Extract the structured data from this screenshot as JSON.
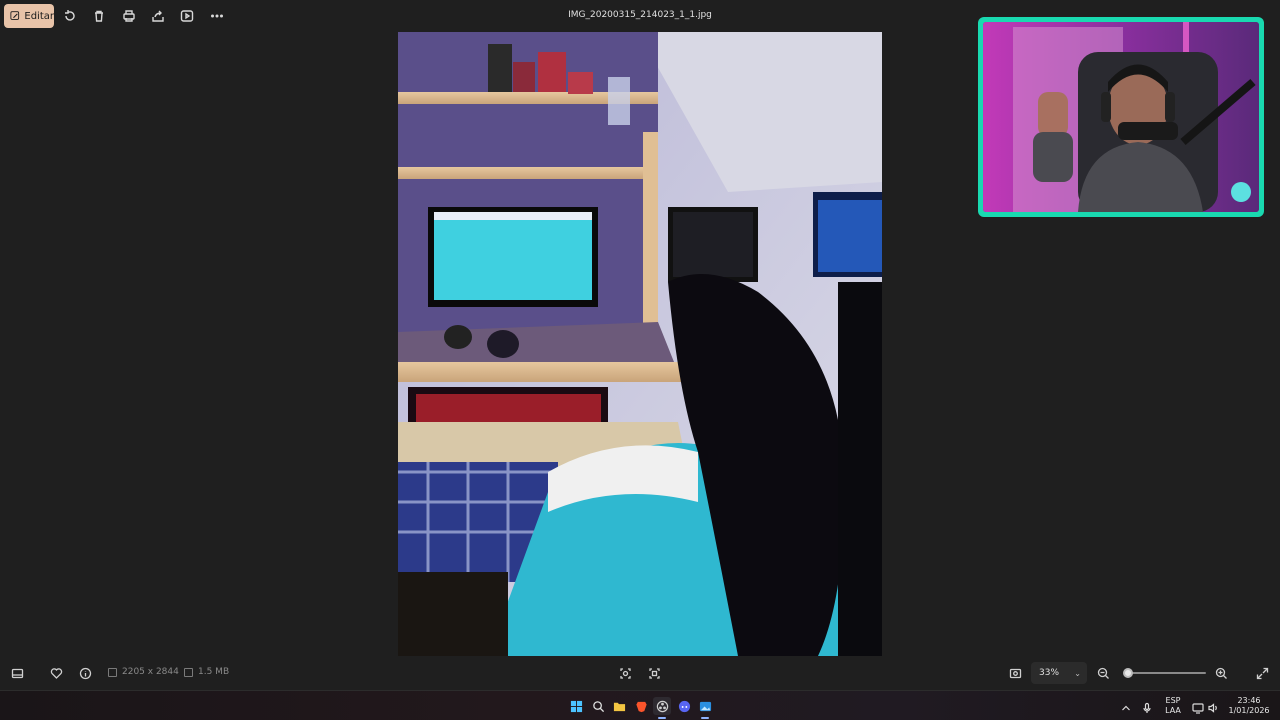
{
  "toolbar": {
    "edit_label": "Editar",
    "icons": [
      "rotate-icon",
      "delete-icon",
      "print-icon",
      "share-icon",
      "slideshow-icon",
      "more-icon"
    ]
  },
  "file": {
    "name": "IMG_20200315_214023_1_1.jpg",
    "dimensions": "2205 x 2844",
    "size": "1.5 MB"
  },
  "zoom": {
    "level": "33%",
    "slider_fraction": 0.05
  },
  "taskbar": {
    "language_line1": "ESP",
    "language_line2": "LAA",
    "time": "23:46",
    "date": "1/01/2026"
  },
  "colors": {
    "accent": "#e8c3a8",
    "cam_border": "#19d9b0",
    "background": "#1f1f1f"
  }
}
